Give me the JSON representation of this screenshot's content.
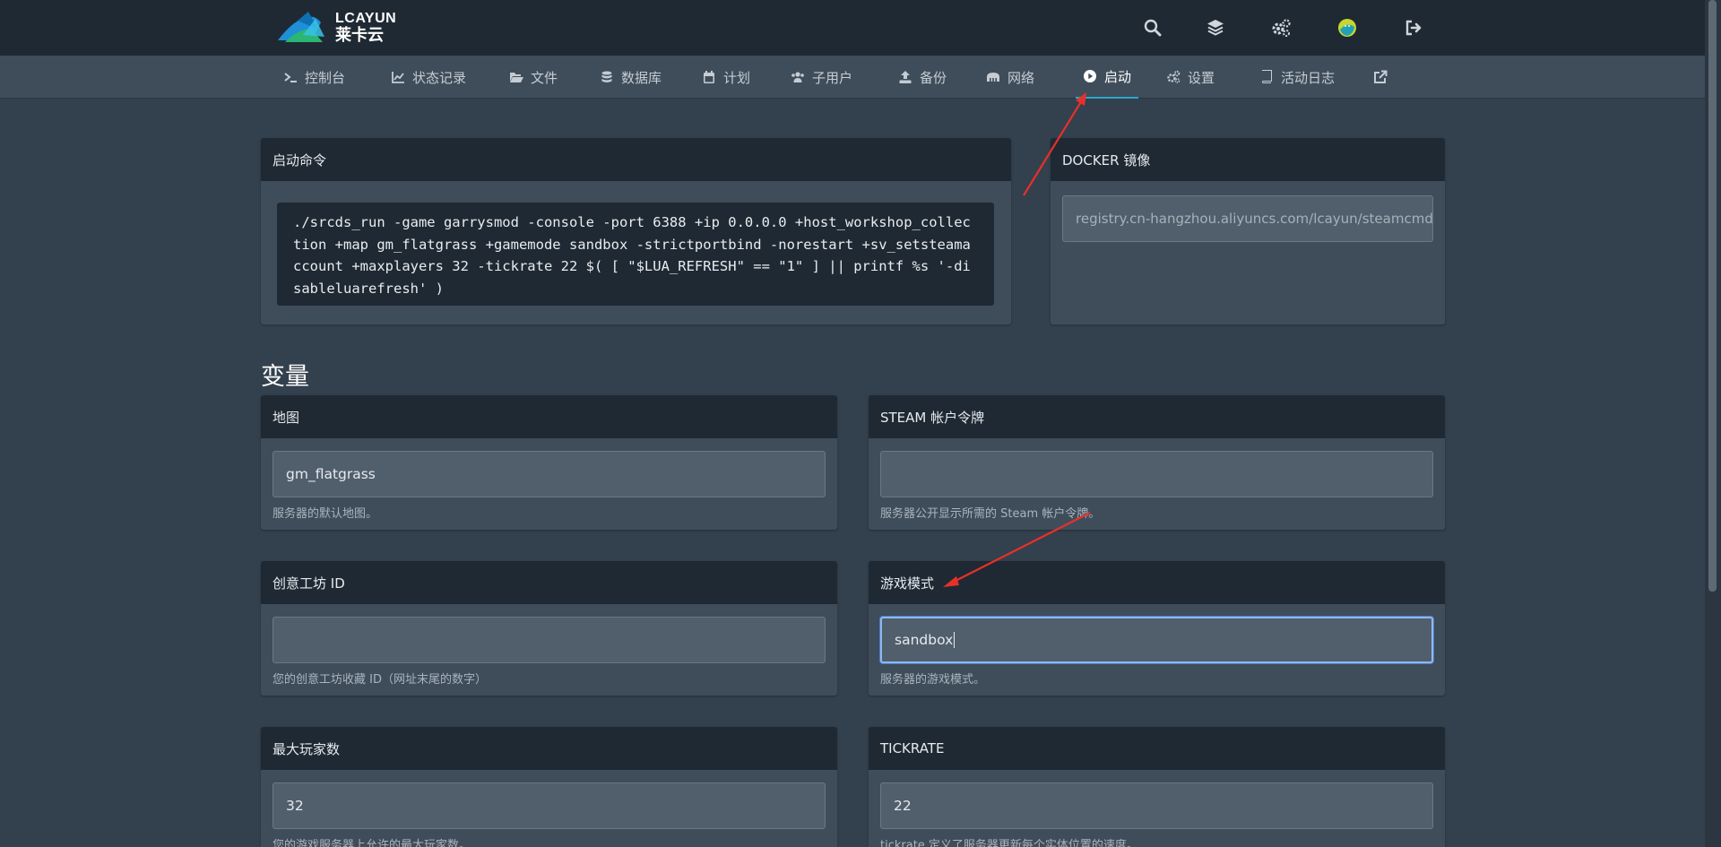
{
  "brand": {
    "name_en": "LCAYUN",
    "name_cn": "莱卡云"
  },
  "header_icons": [
    "search-icon",
    "layers-icon",
    "cogs-icon",
    "avatar",
    "logout-icon"
  ],
  "nav": [
    {
      "label": "控制台",
      "icon": "terminal-icon"
    },
    {
      "label": "状态记录",
      "icon": "chart-icon"
    },
    {
      "label": "文件",
      "icon": "folder-open-icon"
    },
    {
      "label": "数据库",
      "icon": "database-icon"
    },
    {
      "label": "计划",
      "icon": "calendar-icon"
    },
    {
      "label": "子用户",
      "icon": "users-icon"
    },
    {
      "label": "备份",
      "icon": "upload-icon"
    },
    {
      "label": "网络",
      "icon": "network-icon"
    },
    {
      "label": "启动",
      "icon": "play-circle-icon"
    },
    {
      "label": "设置",
      "icon": "cogs-icon"
    },
    {
      "label": "活动日志",
      "icon": "book-icon"
    },
    {
      "label": "",
      "icon": "external-link-icon"
    }
  ],
  "active_nav_color": "#2ba7c9",
  "startup": {
    "title": "启动命令",
    "command": "./srcds_run -game garrysmod -console -port 6388 +ip 0.0.0.0 +host_workshop_collection +map gm_flatgrass +gamemode sandbox -strictportbind -norestart +sv_setsteamaccount +maxplayers 32 -tickrate 22 $( [ \"$LUA_REFRESH\" == \"1\" ] || printf %s '-disableluarefresh' )"
  },
  "docker": {
    "title": "DOCKER 镜像",
    "value": "registry.cn-hangzhou.aliyuncs.com/lcayun/steamcmd"
  },
  "variables": {
    "title": "变量",
    "items": [
      {
        "label": "地图",
        "value": "gm_flatgrass",
        "hint": "服务器的默认地图。"
      },
      {
        "label": "STEAM 帐户令牌",
        "value": "",
        "hint": "服务器公开显示所需的 Steam 帐户令牌。"
      },
      {
        "label": "创意工坊 ID",
        "value": "",
        "hint": "您的创意工坊收藏 ID（网址末尾的数字）"
      },
      {
        "label": "游戏模式",
        "value": "sandbox",
        "hint": "服务器的游戏模式。"
      },
      {
        "label": "最大玩家数",
        "value": "32",
        "hint": "您的游戏服务器上允许的最大玩家数。"
      },
      {
        "label": "TICKRATE",
        "value": "22",
        "hint": "tickrate 定义了服务器更新每个实体位置的速度。"
      }
    ]
  }
}
